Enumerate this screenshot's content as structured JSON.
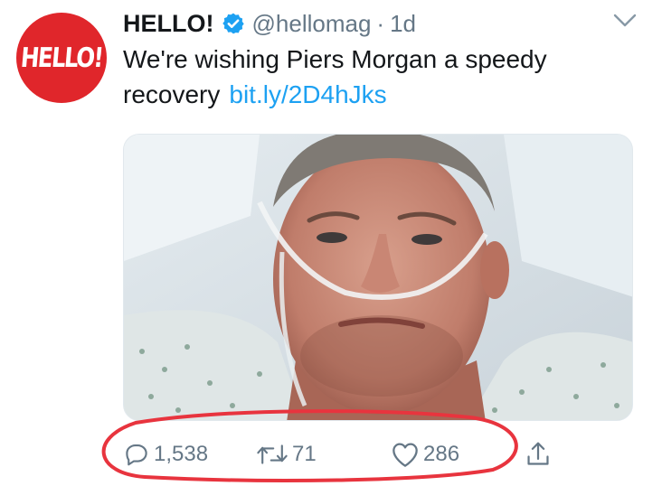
{
  "tweet": {
    "avatar_text": "HELLO!",
    "display_name": "HELLO!",
    "handle": "@hellomag",
    "separator": "·",
    "timestamp": "1d",
    "text": "We're wishing Piers Morgan a speedy recovery",
    "link": "bit.ly/2D4hJks"
  },
  "actions": {
    "replies": "1,538",
    "retweets": "71",
    "likes": "286"
  },
  "icons": {
    "avatar": "hello-logo",
    "verified": "verified-badge-icon",
    "menu": "chevron-down-icon",
    "reply": "reply-icon",
    "retweet": "retweet-icon",
    "like": "heart-icon",
    "share": "share-icon"
  },
  "colors": {
    "brand_red": "#e0262b",
    "link_blue": "#1da1f2",
    "muted_gray": "#657786",
    "annotation_red": "#e8343e"
  }
}
